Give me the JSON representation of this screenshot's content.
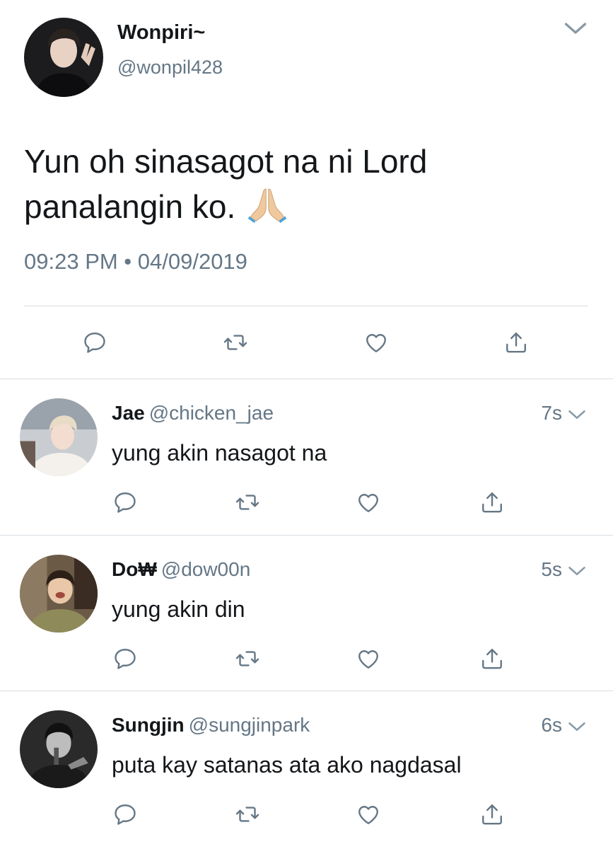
{
  "main_tweet": {
    "display_name": "Wonpiri~",
    "handle": "@wonpil428",
    "text": "Yun oh sinasagot na ni Lord panalangin ko.",
    "emoji": "folded-hands-emoji",
    "timestamp": "09:23 PM • 04/09/2019",
    "actions": [
      "reply-icon",
      "retweet-icon",
      "like-icon",
      "share-icon"
    ]
  },
  "replies": [
    {
      "display_name": "Jae",
      "handle": "@chicken_jae",
      "time": "7s",
      "text": "yung akin nasagot na"
    },
    {
      "display_name": "Do₩",
      "handle": "@dow00n",
      "time": "5s",
      "text": "yung akin din"
    },
    {
      "display_name": "Sungjin",
      "handle": "@sungjinpark",
      "time": "6s",
      "text": "puta kay satanas ata ako nagdasal"
    }
  ],
  "colors": {
    "text": "#14171a",
    "secondary": "#657786",
    "divider": "#d7dde2",
    "icon": "#657786"
  }
}
